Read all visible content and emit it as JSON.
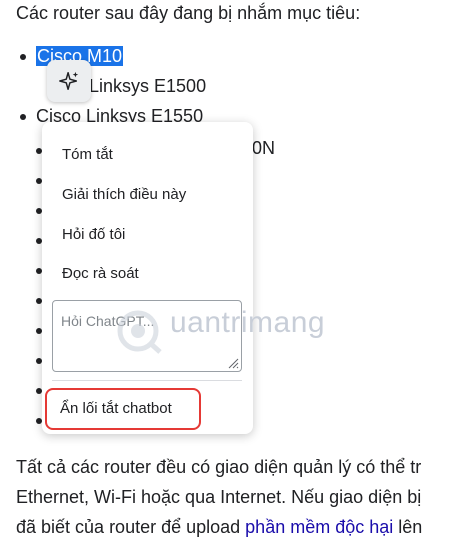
{
  "article": {
    "intro": "Các router sau đây đang bị nhắm mục tiêu:",
    "list": [
      {
        "selected": "Cisco M10",
        "text": ""
      },
      {
        "text": "o Linksys E1500"
      },
      {
        "text": "Cisco Linksys E1550"
      },
      {
        "text": "0N"
      }
    ],
    "paragraph": {
      "line1": "Tất cả các router đều có giao diện quản lý có thể tr",
      "line2": "Ethernet, Wi-Fi hoặc qua Internet. Nếu giao diện bị",
      "line3_before": "đã biết của router để upload ",
      "line3_link": "phần mềm độc hại",
      "line3_after": " lên"
    }
  },
  "menu": {
    "items": [
      "Tóm tắt",
      "Giải thích điều này",
      "Hỏi đố tôi",
      "Đọc rà soát"
    ],
    "ask_placeholder": "Hỏi ChatGPT...",
    "exit_label": "Ẩn lối tắt chatbot"
  },
  "watermark": "uantrimang",
  "colors": {
    "selection": "#1a73e8",
    "highlight_border": "#e53935",
    "link": "#1a0dab"
  },
  "icons": {
    "sparkle_button": "sparkle-icon",
    "textarea_grip": "resize-grip-icon"
  }
}
